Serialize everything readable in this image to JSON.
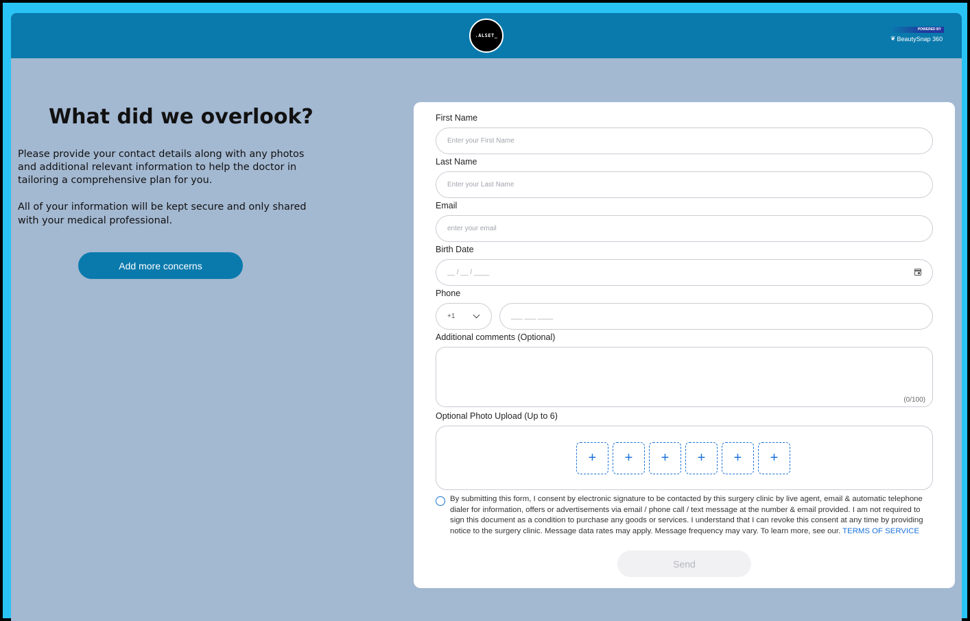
{
  "header": {
    "logo_text": ".ALSET_",
    "powered_by": "POWERED BY",
    "brand": "BeautySnap 360"
  },
  "intro": {
    "title": "What did we overlook?",
    "paragraph1": "Please provide your contact details along with any photos and additional relevant information to help the doctor in tailoring a comprehensive plan for you.",
    "paragraph2": "All of your information will be kept secure and only shared with your medical professional.",
    "add_button": "Add more concerns"
  },
  "form": {
    "first_name": {
      "label": "First Name",
      "placeholder": "Enter your First Name"
    },
    "last_name": {
      "label": "Last Name",
      "placeholder": "Enter your Last Name"
    },
    "email": {
      "label": "Email",
      "placeholder": "enter your email"
    },
    "birth_date": {
      "label": "Birth Date",
      "placeholder": "__ / __ / ____"
    },
    "phone": {
      "label": "Phone",
      "country_code": "+1",
      "placeholder": "___ ___ ____"
    },
    "comments": {
      "label": "Additional comments (Optional)",
      "counter": "(0/100)"
    },
    "upload": {
      "label": "Optional Photo Upload (Up to 6)",
      "slot_symbol": "+"
    },
    "consent": {
      "text": "By submitting this form, I consent by electronic signature to be contacted by this surgery clinic by live agent, email & automatic telephone dialer for information, offers or advertisements via email / phone call / text message at the number & email provided. I am not required to sign this document as a condition to purchase any goods or services. I understand that I can revoke this consent at any time by providing notice to the surgery clinic. Message data rates may apply. Message frequency may vary. To learn more, see our.",
      "link": "TERMS OF SERVICE"
    },
    "send_label": "Send"
  },
  "colors": {
    "frame": "#29c4f5",
    "header": "#0a7aad",
    "background": "#a3b8d1",
    "accent": "#1a73d9"
  }
}
